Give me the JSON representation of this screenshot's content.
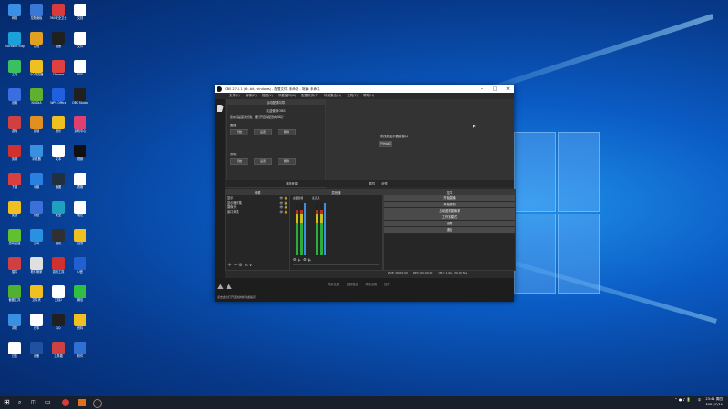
{
  "desktop": {
    "icons": [
      {
        "label": "网络",
        "color": "#3a8ee6"
      },
      {
        "label": "控制面板",
        "color": "#3a78d8"
      },
      {
        "label": "360安全卫士",
        "color": "#d83b3b"
      },
      {
        "label": "文档",
        "color": "#ffffff"
      },
      {
        "label": "Microsoft Edge",
        "color": "#1ba0d8"
      },
      {
        "label": "吉他",
        "color": "#e0a020"
      },
      {
        "label": "相册",
        "color": "#202020"
      },
      {
        "label": "文件",
        "color": "#ffffff"
      },
      {
        "label": "工具",
        "color": "#3ac060"
      },
      {
        "label": "QQ浏览器",
        "color": "#f0c020"
      },
      {
        "label": "Chrome",
        "color": "#e04040"
      },
      {
        "label": "PDF",
        "color": "#ffffff"
      },
      {
        "label": "设置",
        "color": "#3a6ee0"
      },
      {
        "label": "NVIDIA",
        "color": "#60b030"
      },
      {
        "label": "WPS Office",
        "color": "#2060e0"
      },
      {
        "label": "OBS Studio",
        "color": "#202020"
      },
      {
        "label": "游戏",
        "color": "#d04040"
      },
      {
        "label": "阅读",
        "color": "#e09020"
      },
      {
        "label": "音乐",
        "color": "#f0c020"
      },
      {
        "label": "游戏中心",
        "color": "#e04070"
      },
      {
        "label": "剪辑",
        "color": "#d03030"
      },
      {
        "label": "浏览器",
        "color": "#3a90e0"
      },
      {
        "label": "文本",
        "color": "#ffffff"
      },
      {
        "label": "视频",
        "color": "#101010"
      },
      {
        "label": "下载",
        "color": "#d84040"
      },
      {
        "label": "电脑",
        "color": "#2a80e0"
      },
      {
        "label": "截图",
        "color": "#203040"
      },
      {
        "label": "表格",
        "color": "#ffffff"
      },
      {
        "label": "奖励",
        "color": "#f0c020"
      },
      {
        "label": "系统",
        "color": "#3a70d8"
      },
      {
        "label": "安全",
        "color": "#20a0c0"
      },
      {
        "label": "笔记",
        "color": "#ffffff"
      },
      {
        "label": "游戏加速",
        "color": "#60c030"
      },
      {
        "label": "天气",
        "color": "#2a90e0"
      },
      {
        "label": "相机",
        "color": "#303030"
      },
      {
        "label": "记录",
        "color": "#f0c020"
      },
      {
        "label": "插件",
        "color": "#d04040"
      },
      {
        "label": "软件管家",
        "color": "#e0e0e0"
      },
      {
        "label": "游戏工具",
        "color": "#d03030"
      },
      {
        "label": "U盘",
        "color": "#2060d0"
      },
      {
        "label": "截图工具",
        "color": "#50b030"
      },
      {
        "label": "文件夹",
        "color": "#f0c020"
      },
      {
        "label": "文档2",
        "color": "#ffffff"
      },
      {
        "label": "微信",
        "color": "#30c040"
      },
      {
        "label": "浏览",
        "color": "#3a90e0"
      },
      {
        "label": "记事",
        "color": "#ffffff"
      },
      {
        "label": "QQ",
        "color": "#202020"
      },
      {
        "label": "资料",
        "color": "#f0c020"
      },
      {
        "label": "日志",
        "color": "#ffffff"
      },
      {
        "label": "设备",
        "color": "#2050a0"
      },
      {
        "label": "工具箱",
        "color": "#d04040"
      },
      {
        "label": "软件",
        "color": "#3070d0"
      }
    ]
  },
  "obs": {
    "title": "OBS 27.0.1 (64-bit, windows) - 配置文件: 未命名 - 场景: 未命名",
    "menu": [
      "文件(F)",
      "编辑(E)",
      "视图(V)",
      "停靠窗口(D)",
      "配置文件(P)",
      "场景集合(S)",
      "工具(T)",
      "帮助(H)"
    ],
    "auto_config": {
      "header": "自动配置向导",
      "sub": "欢迎使用OBS",
      "text": "您似乎是首次使用，要打开自动配置向导吗？",
      "section1": "直播",
      "section2": "录制",
      "buttons": [
        "开始",
        "设置",
        "删除"
      ]
    },
    "preview": {
      "text": "未找到显示器或窗口",
      "button": "开始捕获"
    },
    "source_tab": "未选来源",
    "props_tab": "属性",
    "filter_tab": "滤镜",
    "scenes_header": "来源",
    "sources": [
      "显示",
      "显示器采集",
      "摄像头",
      "窗口采集"
    ],
    "mixer_header": "混音器",
    "mixer_channels": [
      "桌面音频",
      "麦克风"
    ],
    "controls_header": "控件",
    "controls": [
      "开始直播",
      "开始录制",
      "启动虚拟摄像机",
      "工作室模式",
      "设置",
      "退出"
    ],
    "status": {
      "live": "LIVE: 00:00:00",
      "rec": "REC: 00:00:00",
      "cpu": "CPU: 1.0%, 30.00 fps"
    },
    "bottom_tabs": [
      "场景过渡",
      "音频混合",
      "转场设置",
      "控件"
    ],
    "bottom_text": "点击此处打开连续的新功能提示"
  },
  "taskbar": {
    "time": "23:41 周四",
    "date": "2021/7/11",
    "lang": "中"
  }
}
